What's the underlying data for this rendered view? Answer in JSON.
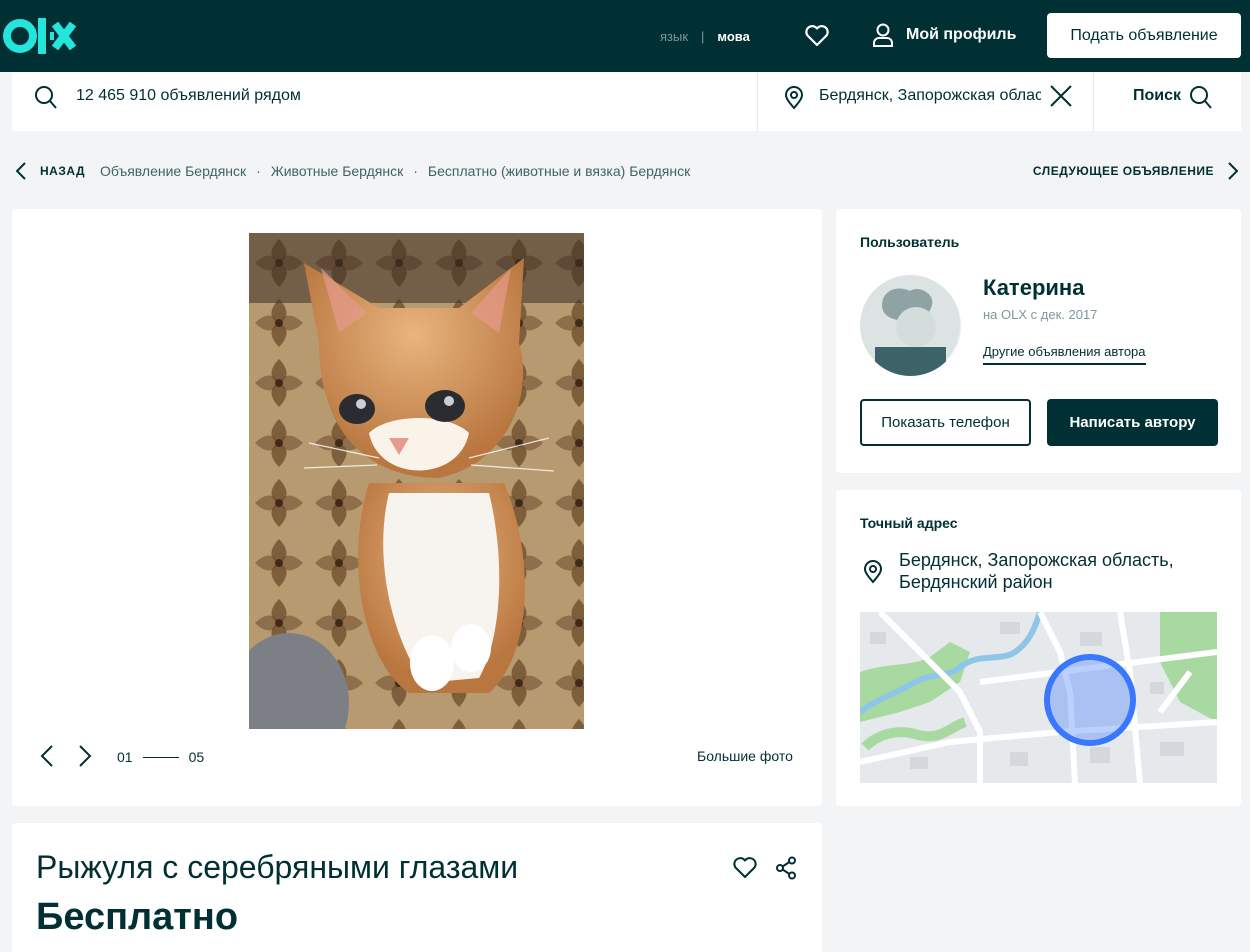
{
  "header": {
    "logo": "olx",
    "lang_ru": "язык",
    "lang_ua": "мова",
    "profile_label": "Мой профиль",
    "post_button": "Подать объявление"
  },
  "search": {
    "query_text": "12 465 910 объявлений рядом",
    "location_text": "Бердянск, Запорожская область",
    "search_button": "Поиск"
  },
  "breadcrumb": {
    "back": "НАЗАД",
    "items": [
      "Объявление Бердянск",
      "Животные Бердянск",
      "Бесплатно (животные и вязка) Бердянск"
    ],
    "separator": "·",
    "next": "СЛЕДУЮЩЕЕ ОБЪЯВЛЕНИЕ"
  },
  "gallery": {
    "current": "01",
    "total": "05",
    "big_photos": "Большие фото"
  },
  "listing": {
    "title": "Рыжуля с серебряными глазами",
    "price": "Бесплатно"
  },
  "user": {
    "section_label": "Пользователь",
    "name": "Катерина",
    "since": "на OLX с дек. 2017",
    "other_ads": "Другие объявления автора",
    "show_phone": "Показать телефон",
    "write_author": "Написать автору"
  },
  "address": {
    "section_label": "Точный адрес",
    "location": "Бердянск, Запорожская область, Бердянский район"
  },
  "colors": {
    "brand_dark": "#002f34",
    "brand_teal": "#23e5db",
    "page_bg": "#f2f4f5",
    "map_circle": "#3a77ff"
  },
  "icons": [
    "search-icon",
    "location-pin-icon",
    "close-icon",
    "heart-icon",
    "user-icon",
    "chevron-left-icon",
    "chevron-right-icon",
    "share-icon"
  ]
}
